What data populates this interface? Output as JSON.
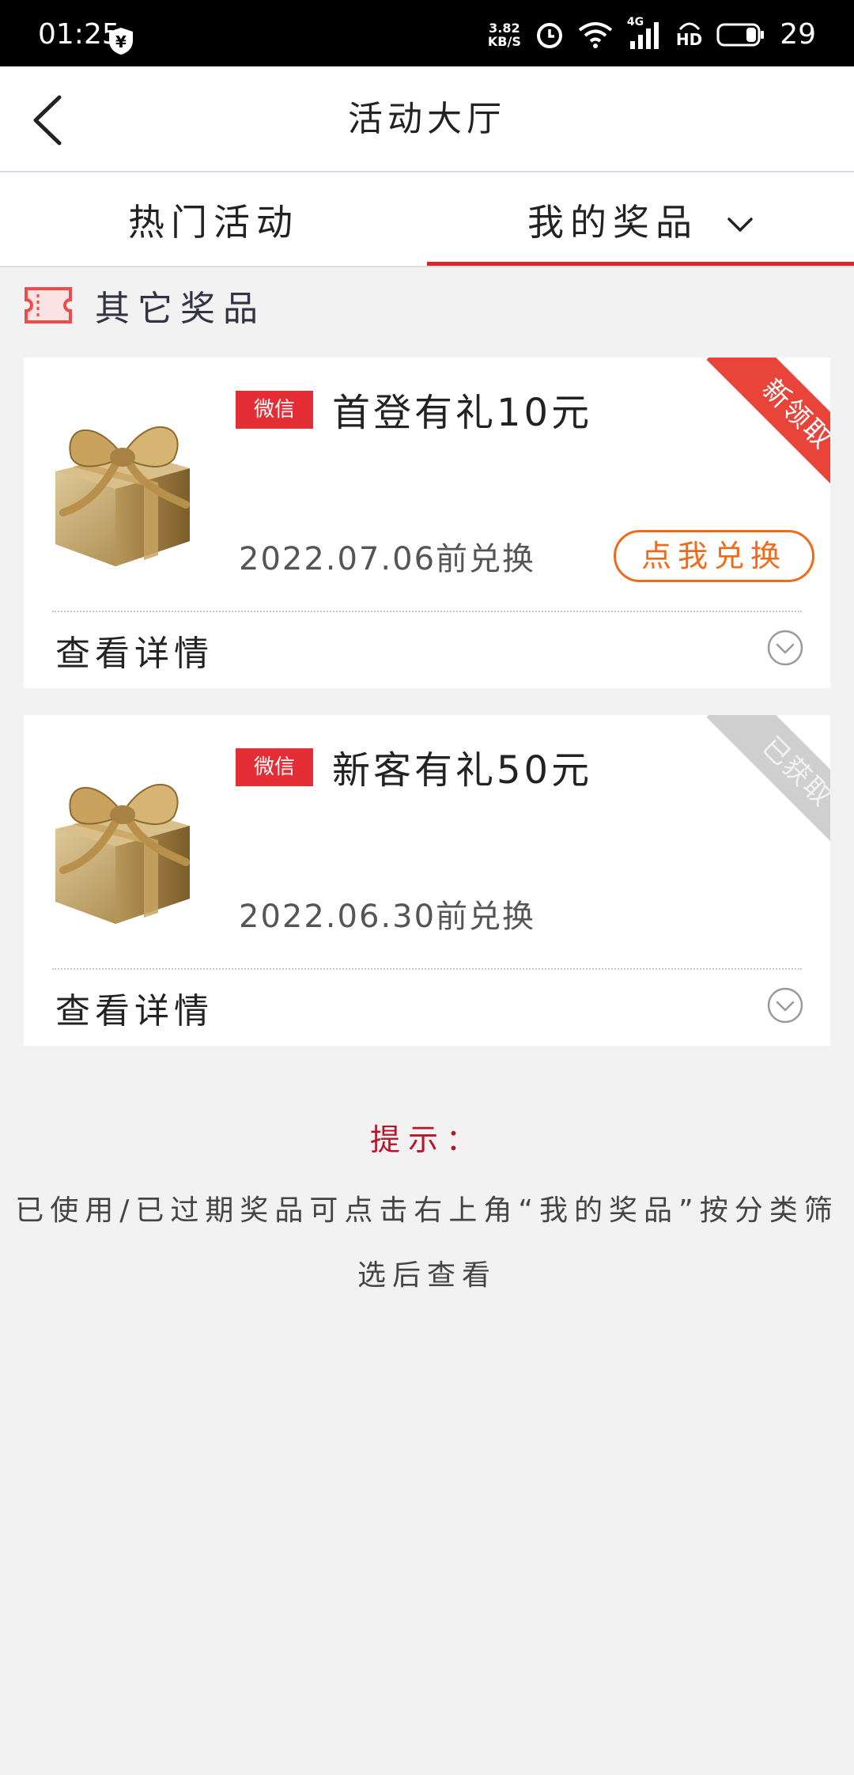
{
  "status_bar": {
    "time": "01:25",
    "net_speed_value": "3.82",
    "net_speed_unit": "KB/S",
    "network_type": "4G",
    "hd_label": "HD",
    "battery_percent": "29"
  },
  "header": {
    "title": "活动大厅"
  },
  "tabs": [
    {
      "label": "热门活动",
      "active": false
    },
    {
      "label": "我的奖品",
      "active": true
    }
  ],
  "section": {
    "title": "其它奖品"
  },
  "prizes": [
    {
      "tag": "微信",
      "title": "首登有礼10元",
      "expiry": "2022.07.06前兑换",
      "ribbon": "新领取",
      "action_label": "点我兑换",
      "details_label": "查看详情"
    },
    {
      "tag": "微信",
      "title": "新客有礼50元",
      "expiry": "2022.06.30前兑换",
      "ribbon": "已获取",
      "details_label": "查看详情"
    }
  ],
  "tip": {
    "title": "提示：",
    "body": "已使用/已过期奖品可点击右上角“我的奖品”按分类筛选后查看"
  },
  "colors": {
    "accent_red": "#d6252f",
    "tag_red": "#e52d35",
    "redeem_orange": "#f06a1a",
    "ribbon_new": "#e8443a",
    "ribbon_got": "#cfcfcf",
    "tip_title": "#b5162a"
  }
}
